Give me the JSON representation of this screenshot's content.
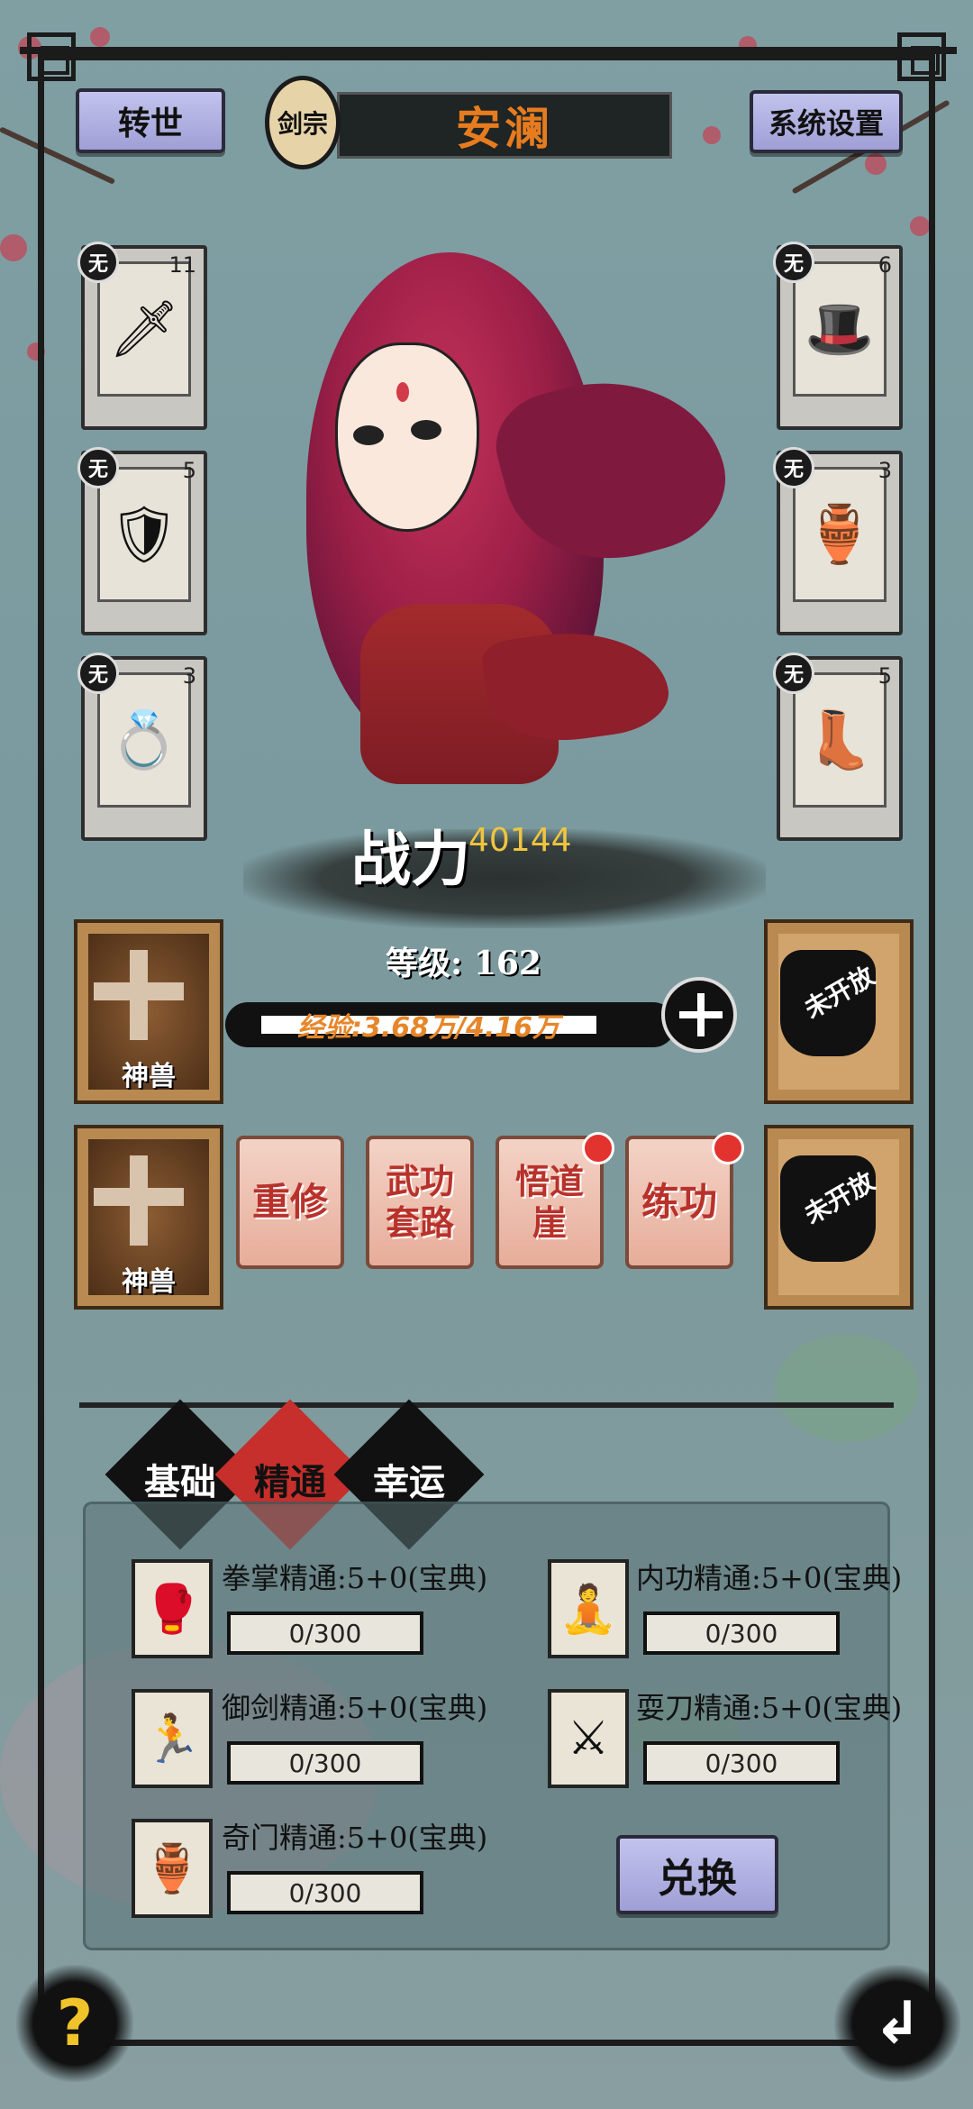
{
  "top_bar": {
    "rebirth_label": "转世",
    "sect_label": "剑宗",
    "character_name": "安澜",
    "settings_label": "系统设置"
  },
  "equipment": {
    "badge": "无",
    "left": [
      {
        "icon": "sword-icon",
        "glyph": "🗡",
        "level": "11"
      },
      {
        "icon": "armor-icon",
        "glyph": "🛡",
        "level": "5"
      },
      {
        "icon": "ring-icon",
        "glyph": "💍",
        "level": "3"
      }
    ],
    "right": [
      {
        "icon": "hat-icon",
        "glyph": "🎩",
        "level": "6"
      },
      {
        "icon": "gourd-icon",
        "glyph": "🏺",
        "level": "3"
      },
      {
        "icon": "boots-icon",
        "glyph": "👢",
        "level": "5"
      }
    ]
  },
  "power": {
    "label": "战力",
    "value": "40144"
  },
  "level": {
    "text": "等级: 162"
  },
  "experience": {
    "text": "经验:3.68万/4.16万",
    "fill_fraction": 0.885
  },
  "beasts": [
    {
      "label": "神兽"
    },
    {
      "label": "神兽"
    }
  ],
  "locked_slots": [
    {
      "label": "未开放"
    },
    {
      "label": "未开放"
    }
  ],
  "actions": [
    {
      "label": "重修",
      "notification": false
    },
    {
      "label": "武功套路",
      "notification": false
    },
    {
      "label": "悟道崖",
      "notification": true
    },
    {
      "label": "练功",
      "notification": true
    }
  ],
  "tabs": [
    {
      "label": "基础",
      "active": false
    },
    {
      "label": "精通",
      "active": true
    },
    {
      "label": "幸运",
      "active": false
    }
  ],
  "skills": [
    {
      "name": "拳掌精通:5+0(宝典)",
      "progress": "0/300",
      "icon": "boxer-icon"
    },
    {
      "name": "内功精通:5+0(宝典)",
      "progress": "0/300",
      "icon": "meditation-icon"
    },
    {
      "name": "御剑精通:5+0(宝典)",
      "progress": "0/300",
      "icon": "runner-icon"
    },
    {
      "name": "耍刀精通:5+0(宝典)",
      "progress": "0/300",
      "icon": "crossed-blades-icon"
    },
    {
      "name": "奇门精通:5+0(宝典)",
      "progress": "0/300",
      "icon": "gourd-weapon-icon"
    }
  ],
  "exchange_label": "兑换",
  "help_label": "?",
  "back_label": "↲",
  "colors": {
    "accent_orange": "#e67c1f",
    "power_gold": "#f0c53e",
    "action_red": "#b8322b",
    "notify_red": "#e3332f"
  }
}
